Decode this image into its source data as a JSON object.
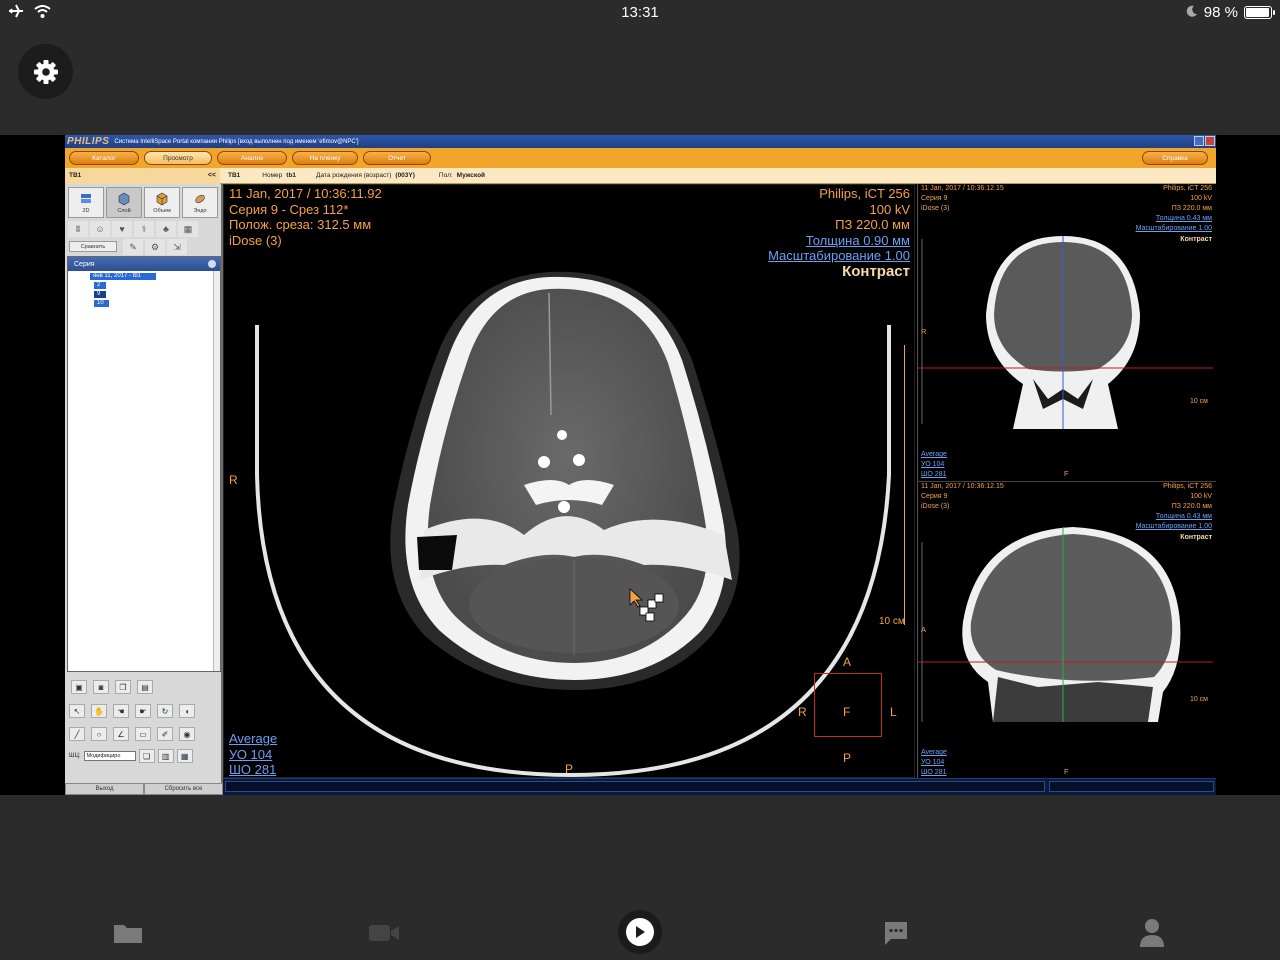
{
  "status_bar": {
    "time": "13:31",
    "battery_text": "98 %",
    "battery_level": 0.98,
    "icons": [
      "airplane-icon",
      "wifi-icon",
      "moon-icon",
      "battery-icon"
    ]
  },
  "app": {
    "settings_icon": "gear-icon",
    "title_logo": "PHILIPS",
    "window_title": "Система IntelliSpace Portal компании Philips [вход выполнен под именем 'efimov@NPC']",
    "menu": {
      "catalog": "Каталог",
      "view": "Просмотр",
      "analysis": "Анализ",
      "film": "На пленку",
      "report": "Отчет",
      "help": "Справка"
    },
    "patient_bar": {
      "tab": "TB1",
      "collapse": "<<",
      "name": "TB1",
      "number_label": "Номер",
      "number": "tb1",
      "dob_label": "Дата рождения (возраст)",
      "dob": "(003Y)",
      "sex_label": "Пол:",
      "sex": "Мужской"
    },
    "left_panel": {
      "modes": [
        "2D",
        "Слой",
        "Объем",
        "Эндо"
      ],
      "compare": "Сравнить",
      "series_title": "Серия",
      "study": "янв 11, 2017 - tb1",
      "series_items": [
        "2",
        "9",
        "10"
      ],
      "shd_label": "ШЦ:",
      "modify_select": "Модифициро",
      "exit": "Выход",
      "reset_all": "Сбросить все"
    },
    "main_viewport": {
      "date": "11 Jan, 2017 / 10:36:11.92",
      "series": "Серия 9 - Срез 112*",
      "position": "Полож. среза: 312.5 мм",
      "idose": "iDose (3)",
      "scanner": "Philips, iCT 256",
      "kv": "100 kV",
      "fov": "ПЗ 220.0 мм",
      "thickness": "Толщина 0.90 мм",
      "scale": "Масштабирование 1.00",
      "contrast": "Контраст",
      "average": "Average",
      "wl": "УО   104",
      "ww": "ШО   281",
      "ruler": "10 см",
      "orient_left": "R",
      "orient_bottom": "P",
      "cube": {
        "top": "A",
        "left": "R",
        "center": "F",
        "right": "L",
        "bottom": "P"
      }
    },
    "coronal_viewport": {
      "date": "11 Jan, 2017 / 10:36:12.15",
      "series": "Серия 9",
      "idose": "iDose (3)",
      "scanner": "Philips, iCT 256",
      "kv": "100 kV",
      "fov": "ПЗ 220.0 мм",
      "thickness": "Толщина 0.43 мм",
      "scale": "Масштабирование 1.00",
      "contrast": "Контраст",
      "average": "Average",
      "wl": "УО   104",
      "ww": "ШО   281",
      "ruler": "10 см",
      "orient_left": "R",
      "orient_bottom": "F"
    },
    "sagittal_viewport": {
      "date": "11 Jan, 2017 / 10:36:12.15",
      "series": "Серия 9",
      "idose": "iDose (3)",
      "scanner": "Philips, iCT 256",
      "kv": "100 kV",
      "fov": "ПЗ 220.0 мм",
      "thickness": "Толщина 0.43 мм",
      "scale": "Масштабирование 1.00",
      "contrast": "Контраст",
      "average": "Average",
      "wl": "УО   104",
      "ww": "ШО   281",
      "ruler": "10 см",
      "orient_left": "A",
      "orient_bottom": "F"
    }
  },
  "tab_bar": {
    "icons": [
      "folder-icon",
      "video-camera-icon",
      "play-icon",
      "chat-icon",
      "person-icon"
    ]
  }
}
